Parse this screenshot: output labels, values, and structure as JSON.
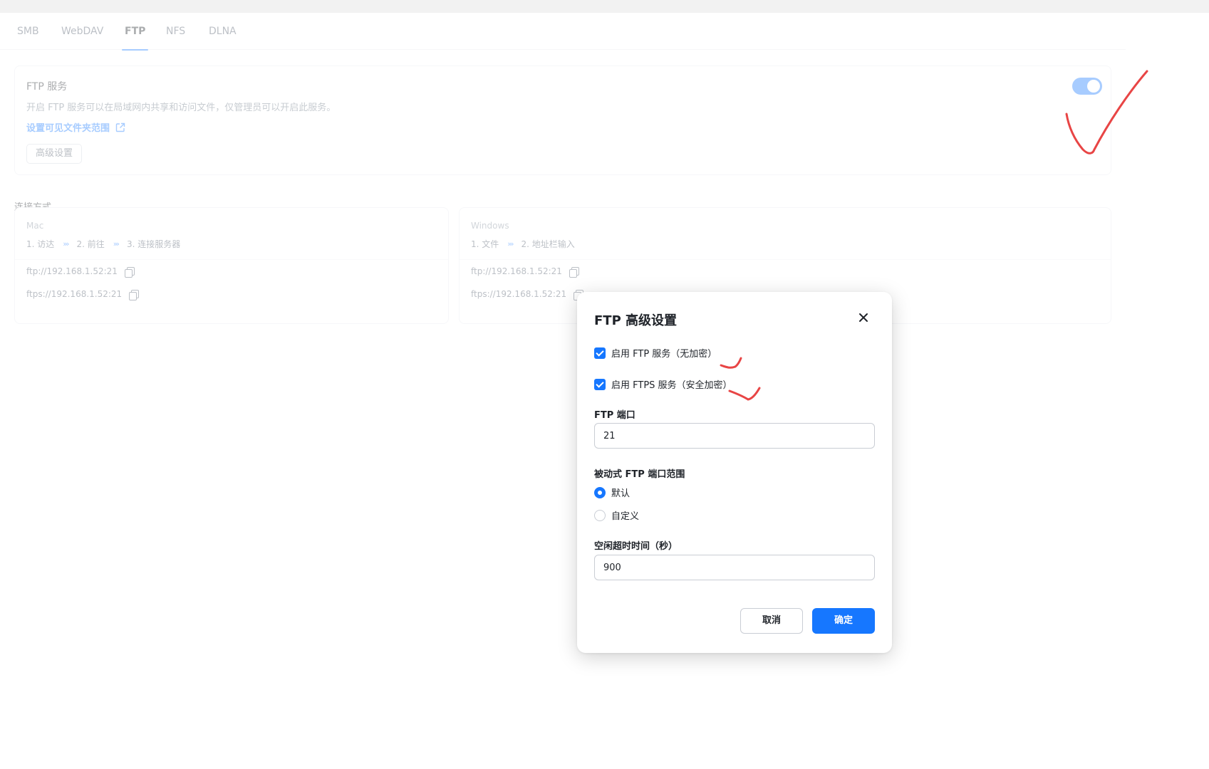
{
  "tabs": [
    {
      "label": "SMB"
    },
    {
      "label": "WebDAV"
    },
    {
      "label": "FTP",
      "active": true
    },
    {
      "label": "NFS"
    },
    {
      "label": "DLNA"
    }
  ],
  "service": {
    "title": "FTP 服务",
    "description": "开启 FTP 服务可以在局域网内共享和访问文件，仅管理员可以开启此服务。",
    "visible_folder_link": "设置可见文件夹范围",
    "advanced_button": "高级设置",
    "enabled": true
  },
  "connection": {
    "title": "连接方式",
    "mac": {
      "os": "Mac",
      "steps": [
        "1. 访达",
        "2. 前往",
        "3. 连接服务器"
      ],
      "addresses": [
        "ftp://192.168.1.52:21",
        "ftps://192.168.1.52:21"
      ]
    },
    "windows": {
      "os": "Windows",
      "steps": [
        "1. 文件",
        "2. 地址栏输入"
      ],
      "addresses": [
        "ftp://192.168.1.52:21",
        "ftps://192.168.1.52:21"
      ]
    },
    "step_separator": "›››"
  },
  "modal": {
    "title": "FTP 高级设置",
    "checkboxes": [
      {
        "label": "启用 FTP 服务（无加密）",
        "checked": true
      },
      {
        "label": "启用 FTPS 服务（安全加密）",
        "checked": true
      }
    ],
    "port_label": "FTP 端口",
    "port_value": "21",
    "passive_label": "被动式 FTP 端口范围",
    "passive_options": [
      {
        "label": "默认",
        "selected": true
      },
      {
        "label": "自定义",
        "selected": false
      }
    ],
    "timeout_label": "空闲超时时间（秒）",
    "timeout_value": "900",
    "cancel_label": "取消",
    "ok_label": "确定"
  },
  "colors": {
    "accent": "#1677ff",
    "annotation": "#e84545"
  }
}
